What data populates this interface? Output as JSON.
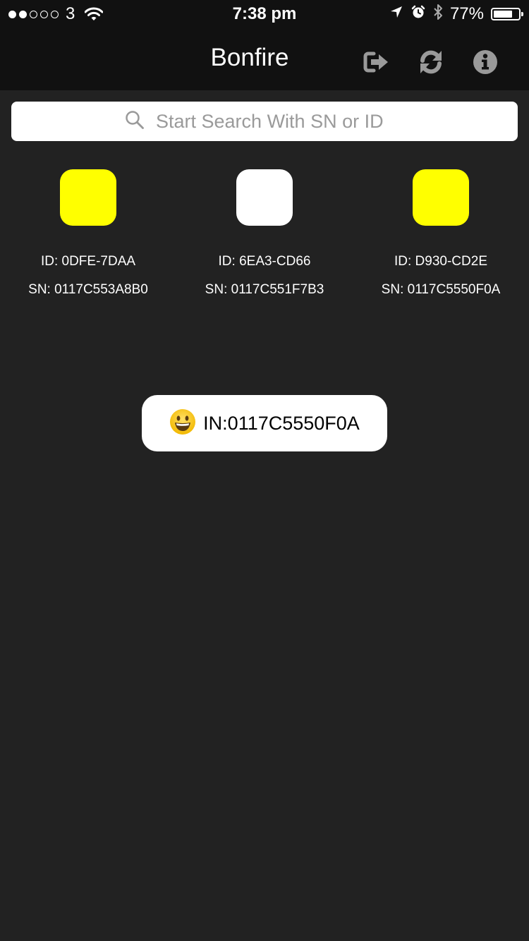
{
  "status_bar": {
    "signal_bars_filled": 2,
    "signal_bars_total": 5,
    "carrier": "3",
    "time": "7:38 pm",
    "battery_percent_text": "77%",
    "battery_level": 0.77
  },
  "nav": {
    "title": "Bonfire",
    "icons": [
      "logout-icon",
      "refresh-icon",
      "info-icon"
    ]
  },
  "search": {
    "placeholder": "Start Search With SN or ID",
    "value": ""
  },
  "devices": [
    {
      "id": "ID: 0DFE-7DAA",
      "sn": "SN: 0117C553A8B0",
      "color": "#ffff00"
    },
    {
      "id": "ID: 6EA3-CD66",
      "sn": "SN: 0117C551F7B3",
      "color": "#ffffff"
    },
    {
      "id": "ID: D930-CD2E",
      "sn": "SN: 0117C5550F0A",
      "color": "#ffff00"
    }
  ],
  "toast": {
    "icon": "smiley-face-icon",
    "text": "IN:0117C5550F0A"
  },
  "colors": {
    "background": "#222222",
    "bar": "#111111",
    "icon_gray": "#9a9a9a",
    "highlight": "#ffff00"
  }
}
